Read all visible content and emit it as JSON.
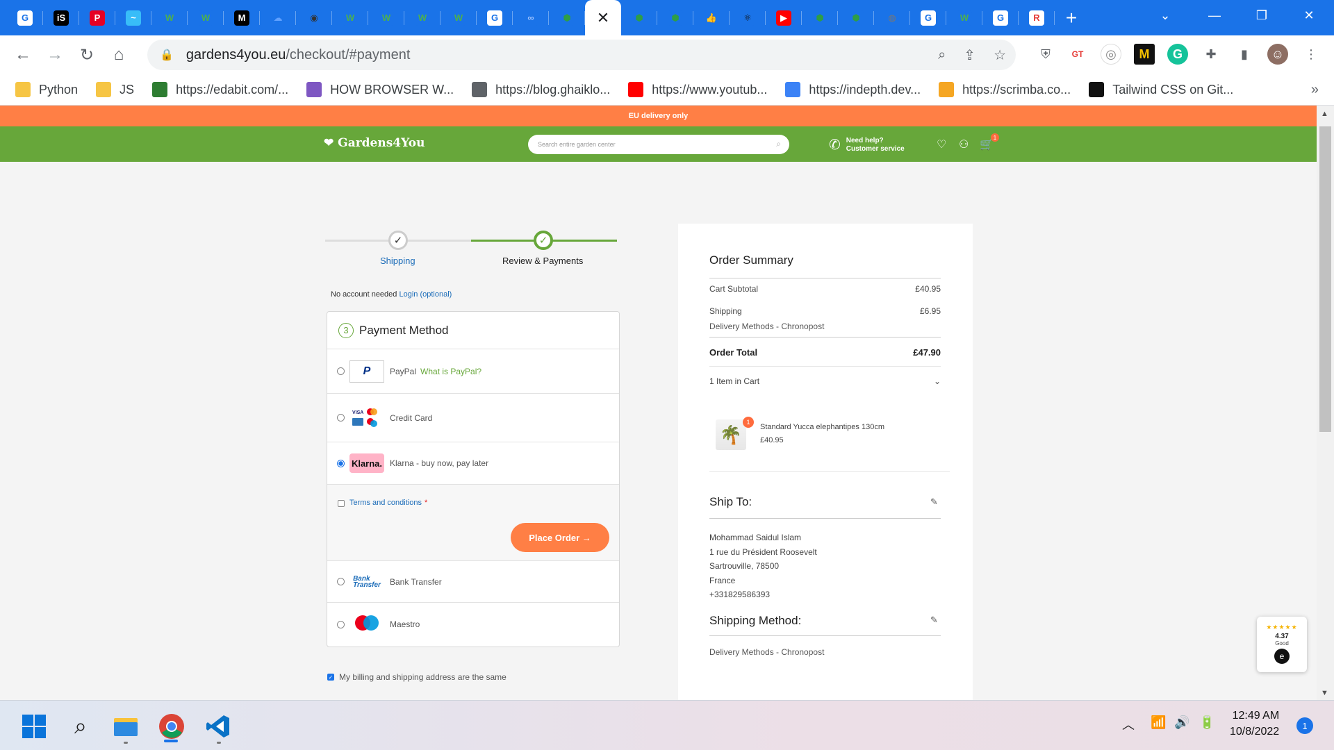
{
  "browser": {
    "tabs": [
      {
        "icon": "google-icon",
        "glyph": "G",
        "color": "#ffffff",
        "fg": "#1a73e8"
      },
      {
        "icon": "is-icon",
        "glyph": "iS",
        "color": "#000000",
        "fg": "#ffffff"
      },
      {
        "icon": "pinterest-icon",
        "glyph": "P",
        "color": "#e60023",
        "fg": "#ffffff"
      },
      {
        "icon": "tailwind-icon",
        "glyph": "~",
        "color": "#38bdf8",
        "fg": "#ffffff"
      },
      {
        "icon": "w-icon",
        "glyph": "W",
        "color": "#1a73e8",
        "fg": "#4caf50"
      },
      {
        "icon": "w-icon",
        "glyph": "W",
        "color": "#1a73e8",
        "fg": "#4caf50"
      },
      {
        "icon": "m-icon",
        "glyph": "M",
        "color": "#000000",
        "fg": "#ffffff"
      },
      {
        "icon": "cloud-icon",
        "glyph": "☁",
        "color": "#1a73e8",
        "fg": "#5fa0ff"
      },
      {
        "icon": "chrome-icon",
        "glyph": "◉",
        "color": "#1a73e8",
        "fg": "#333333"
      },
      {
        "icon": "w-icon",
        "glyph": "W",
        "color": "#1a73e8",
        "fg": "#4caf50"
      },
      {
        "icon": "w-icon",
        "glyph": "W",
        "color": "#1a73e8",
        "fg": "#4caf50"
      },
      {
        "icon": "w-icon",
        "glyph": "W",
        "color": "#1a73e8",
        "fg": "#4caf50"
      },
      {
        "icon": "w-icon",
        "glyph": "W",
        "color": "#1a73e8",
        "fg": "#4caf50"
      },
      {
        "icon": "google-icon",
        "glyph": "G",
        "color": "#ffffff",
        "fg": "#1a73e8"
      },
      {
        "icon": "infinity-icon",
        "glyph": "∞",
        "color": "#1a73e8",
        "fg": "#a0c4ff"
      },
      {
        "icon": "cube-icon",
        "glyph": "⬢",
        "color": "#1a73e8",
        "fg": "#2e9e44"
      }
    ],
    "tabs_right": [
      {
        "icon": "cube-icon",
        "glyph": "⬢",
        "color": "#1a73e8",
        "fg": "#2e9e44"
      },
      {
        "icon": "cube-icon",
        "glyph": "⬢",
        "color": "#1a73e8",
        "fg": "#2e9e44"
      },
      {
        "icon": "thumb-icon",
        "glyph": "👍",
        "color": "#1a73e8",
        "fg": "#ffffff"
      },
      {
        "icon": "react-icon",
        "glyph": "⚛",
        "color": "#1a73e8",
        "fg": "#111111"
      },
      {
        "icon": "youtube-icon",
        "glyph": "▶",
        "color": "#ff0000",
        "fg": "#ffffff"
      },
      {
        "icon": "cube-icon",
        "glyph": "⬢",
        "color": "#1a73e8",
        "fg": "#2e9e44"
      },
      {
        "icon": "cube-icon",
        "glyph": "⬢",
        "color": "#1a73e8",
        "fg": "#2e9e44"
      },
      {
        "icon": "globe-icon",
        "glyph": "◍",
        "color": "#1a73e8",
        "fg": "#777777"
      },
      {
        "icon": "google-icon",
        "glyph": "G",
        "color": "#ffffff",
        "fg": "#1a73e8"
      },
      {
        "icon": "w-icon",
        "glyph": "W",
        "color": "#1a73e8",
        "fg": "#4caf50"
      },
      {
        "icon": "google-icon",
        "glyph": "G",
        "color": "#ffffff",
        "fg": "#1a73e8"
      },
      {
        "icon": "r-icon",
        "glyph": "R",
        "color": "#ffffff",
        "fg": "#e53935"
      }
    ],
    "active_tab_close": "✕",
    "new_tab": "+",
    "url_host": "gardens4you.eu",
    "url_path": "/checkout/#payment",
    "bookmarks": [
      {
        "label": "Python",
        "icon": "folder-icon",
        "color": "#f6c544"
      },
      {
        "label": "JS",
        "icon": "folder-icon",
        "color": "#f6c544"
      },
      {
        "label": "https://edabit.com/...",
        "icon": "edabit-icon",
        "color": "#2e7d32"
      },
      {
        "label": "HOW BROWSER W...",
        "icon": "rocket-icon",
        "color": "#7e57c2"
      },
      {
        "label": "https://blog.ghaiklo...",
        "icon": "globe-icon",
        "color": "#5f6368"
      },
      {
        "label": "https://www.youtub...",
        "icon": "youtube-icon",
        "color": "#ff0000"
      },
      {
        "label": "https://indepth.dev...",
        "icon": "shoe-icon",
        "color": "#3b82f6"
      },
      {
        "label": "https://scrimba.co...",
        "icon": "scrimba-icon",
        "color": "#f5a623"
      },
      {
        "label": "Tailwind CSS on Git...",
        "icon": "github-icon",
        "color": "#111111"
      }
    ],
    "bookmarks_more": "»"
  },
  "site": {
    "promo": "EU delivery only",
    "logo": "Gardens4You",
    "search_placeholder": "Search entire garden center",
    "help_line1": "Need help?",
    "help_line2": "Customer service",
    "cart_count": "1"
  },
  "checkout": {
    "steps": [
      {
        "label": "Shipping",
        "color": "#1a6bb8"
      },
      {
        "label": "Review & Payments",
        "color": "#222222"
      }
    ],
    "account_note": "No account needed",
    "login_link": "Login",
    "login_optional": "(optional)",
    "payment": {
      "step_number": "3",
      "title": "Payment Method",
      "methods": [
        {
          "label": "PayPal",
          "extra": "What is PayPal?",
          "selected": false
        },
        {
          "label": "Credit Card",
          "extra": "",
          "selected": false
        },
        {
          "label": "Klarna - buy now, pay later",
          "extra": "",
          "selected": true
        },
        {
          "label": "Bank Transfer",
          "extra": "",
          "selected": false
        },
        {
          "label": "Maestro",
          "extra": "",
          "selected": false
        }
      ],
      "terms_label": "Terms and conditions",
      "terms_required": "*",
      "place_order": "Place Order →"
    },
    "billing_same": "My billing and shipping address are the same"
  },
  "summary": {
    "title": "Order Summary",
    "subtotal_label": "Cart Subtotal",
    "subtotal_value": "£40.95",
    "shipping_label": "Shipping",
    "shipping_value": "£6.95",
    "shipping_method": "Delivery Methods - Chronopost",
    "total_label": "Order Total",
    "total_value": "£47.90",
    "items_in_cart": "1 Item in Cart",
    "item": {
      "name": "Standard Yucca elephantipes 130cm",
      "price": "£40.95",
      "qty": "1"
    },
    "ship_to_title": "Ship To:",
    "address": [
      "Mohammad Saidul Islam",
      "1 rue du Président Roosevelt",
      "Sartrouville, 78500",
      "France",
      "+331829586393"
    ],
    "shipping_method_title": "Shipping Method:",
    "shipping_method_value": "Delivery Methods - Chronopost"
  },
  "trust_badge": {
    "stars": "★★★★★",
    "score": "4.37",
    "grade": "Good",
    "logo": "e"
  },
  "taskbar": {
    "time": "12:49 AM",
    "date": "10/8/2022",
    "notifications": "1"
  },
  "colors": {
    "brand_green": "#67a73a",
    "accent_orange": "#ff7f45",
    "chrome_blue": "#1a73e8"
  }
}
